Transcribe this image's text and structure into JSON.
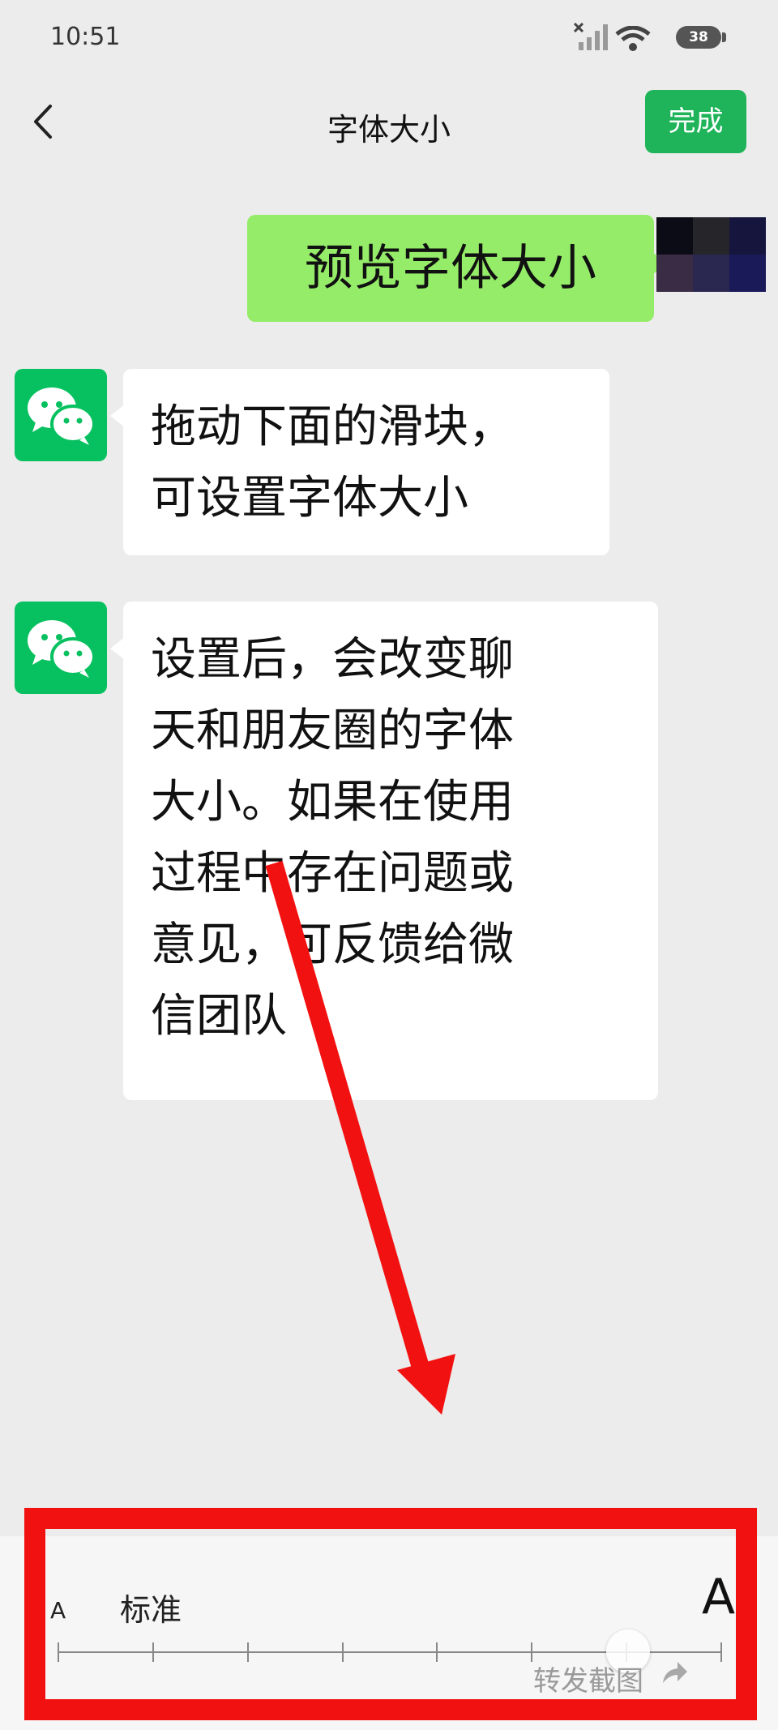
{
  "status_bar": {
    "time": "10:51",
    "battery": "38",
    "icons": [
      "no-signal-icon",
      "wifi-icon",
      "battery-icon"
    ]
  },
  "nav": {
    "back_icon": "back-icon",
    "title": "字体大小",
    "done_label": "完成"
  },
  "chat": {
    "sent_message": "预览字体大小",
    "received_messages": [
      {
        "lines": [
          "拖动下面的滑块，",
          "可设置字体大小"
        ]
      },
      {
        "lines": [
          "设置后，会改变聊",
          "天和朋友圈的字体",
          "大小。如果在使用",
          "过程中存在问题或",
          "意见，可反馈给微",
          "信团队"
        ]
      }
    ],
    "avatar_icon": "wechat-logo-icon"
  },
  "font_slider": {
    "small_label": "A",
    "current_label": "标准",
    "large_label": "A",
    "tick_count": 8,
    "selected_index": 1
  },
  "overlay": {
    "forward_screenshot_label": "转发截图",
    "share_icon": "share-arrow-icon"
  },
  "colors": {
    "accent_green": "#1fb45a",
    "sent_bubble": "#95ec69",
    "annotation_red": "#f21111",
    "background": "#ececec"
  }
}
